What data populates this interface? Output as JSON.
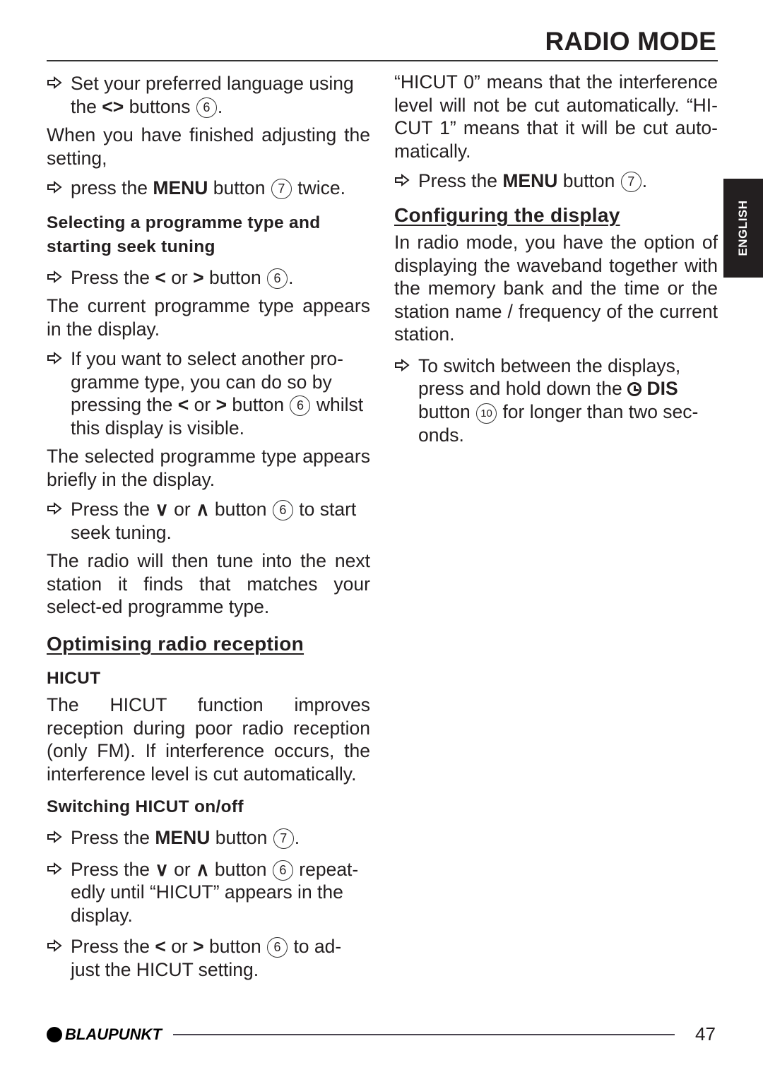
{
  "header": {
    "title": "RADIO MODE"
  },
  "side_tab": {
    "label": "ENGLISH"
  },
  "icons": {
    "step_arrow": "arrow-right-outline-icon",
    "left": "<",
    "right": ">",
    "down": "∨",
    "up": "∧"
  },
  "left": {
    "step1": {
      "text_a": "Set your preferred language using the",
      "text_b": "buttons",
      "num": "6",
      "end": "."
    },
    "para1": "When you have finished adjusting the setting,",
    "step2": {
      "text_a": "press the",
      "bold": "MENU",
      "text_b": "button",
      "num": "7",
      "end": "twice."
    },
    "sub1": "Selecting a programme type and starting seek tuning",
    "step3": {
      "text_a": "Press the",
      "or": "or",
      "text_b": "button",
      "num": "6",
      "end": "."
    },
    "para2": "The current programme type appears in the display.",
    "step4": {
      "text_a": "If you want to select another pro-gramme type, you can do so by pressing the",
      "or": "or",
      "text_b": "button",
      "num": "6",
      "end": "whilst this display is visible."
    },
    "para3": "The selected programme type appears briefly in the display.",
    "step5": {
      "text_a": "Press the",
      "or": "or",
      "text_b": "button",
      "num": "6",
      "end": "to start seek tuning."
    },
    "para4": "The radio will then tune into the next station it finds that matches your select-ed programme type.",
    "section2": "Optimising radio reception",
    "sub2": "HICUT",
    "para5": "The HICUT function improves reception during poor radio reception (only FM). If interference occurs, the interference level is cut automatically.",
    "sub3": "Switching HICUT on/off",
    "step6": {
      "text_a": "Press the",
      "bold": "MENU",
      "text_b": "button",
      "num": "7",
      "end": "."
    },
    "step7": {
      "text_a": "Press the",
      "or": "or",
      "text_b": "button",
      "num": "6",
      "end": "repeat-edly until “HICUT” appears in the display."
    },
    "step8": {
      "text_a": "Press the",
      "or": "or",
      "text_b": "button",
      "num": "6",
      "end": "to ad-just the HICUT setting."
    }
  },
  "right": {
    "para1": "“HICUT 0” means that the interference level will not be cut automatically. “HI-CUT 1” means that it will be cut auto-matically.",
    "step1": {
      "text_a": "Press the",
      "bold": "MENU",
      "text_b": "button",
      "num": "7",
      "end": "."
    },
    "section": "Configuring the display",
    "para2": "In radio mode, you have the option of displaying the waveband together with the memory bank and the time or the station name / frequency of the current station.",
    "step2": {
      "text_a": "To switch between the displays, press and hold down the",
      "bold": "DIS",
      "text_b": "button",
      "num": "10",
      "end": "for longer than two sec-onds."
    }
  },
  "footer": {
    "brand": "BLAUPUNKT",
    "page_number": "47"
  }
}
